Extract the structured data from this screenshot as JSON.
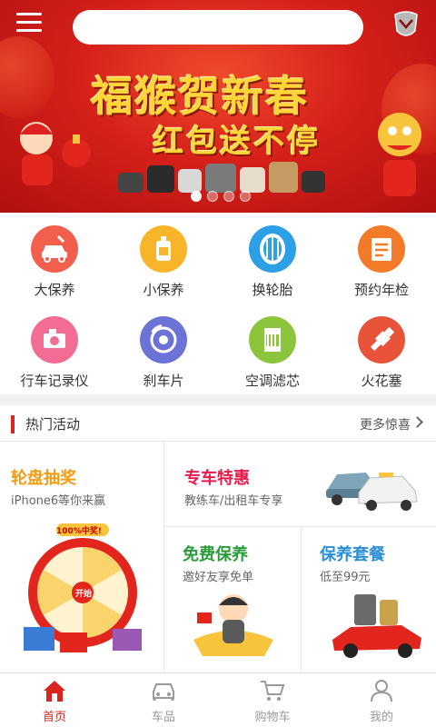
{
  "header": {
    "search": {
      "value": "",
      "placeholder": ""
    },
    "menu_icon": "hamburger-icon",
    "logo_icon": "brand-logo-icon"
  },
  "banner": {
    "headline": "福猴贺新春",
    "subline": "红包送不停",
    "slides": 4,
    "active_slide": 1
  },
  "services": [
    {
      "label": "大保养",
      "icon": "car-service-icon",
      "color": "#f2604d"
    },
    {
      "label": "小保养",
      "icon": "oil-can-icon",
      "color": "#f9b52a"
    },
    {
      "label": "换轮胎",
      "icon": "tire-icon",
      "color": "#2d9fe6"
    },
    {
      "label": "预约年检",
      "icon": "inspection-icon",
      "color": "#f27a28"
    },
    {
      "label": "行车记录仪",
      "icon": "dashcam-icon",
      "color": "#f26c94"
    },
    {
      "label": "刹车片",
      "icon": "brake-disc-icon",
      "color": "#6b74d6"
    },
    {
      "label": "空调滤芯",
      "icon": "air-filter-icon",
      "color": "#8cc43c"
    },
    {
      "label": "火花塞",
      "icon": "spark-plug-icon",
      "color": "#e8543a"
    }
  ],
  "hot": {
    "title": "热门活动",
    "more": "更多惊喜"
  },
  "promos": {
    "lottery": {
      "title": "轮盘抽奖",
      "sub": "iPhone6等你来赢",
      "color": "#f39c12",
      "badge": "100%中奖!",
      "wheel_center": "开始"
    },
    "special": {
      "title": "专车特惠",
      "sub": "教练车/出租车专享",
      "color": "#e8194c"
    },
    "free": {
      "title": "免费保养",
      "sub": "邀好友享免单",
      "color": "#2a9d3a"
    },
    "package": {
      "title": "保养套餐",
      "sub": "低至99元",
      "color": "#2b8fd8"
    }
  },
  "nav": [
    {
      "label": "首页",
      "icon": "home-icon",
      "active": true
    },
    {
      "label": "车品",
      "icon": "car-icon",
      "active": false
    },
    {
      "label": "购物车",
      "icon": "cart-icon",
      "active": false
    },
    {
      "label": "我的",
      "icon": "user-icon",
      "active": false
    }
  ],
  "colors": {
    "brand_red": "#d9251e",
    "inactive_gray": "#999999"
  }
}
